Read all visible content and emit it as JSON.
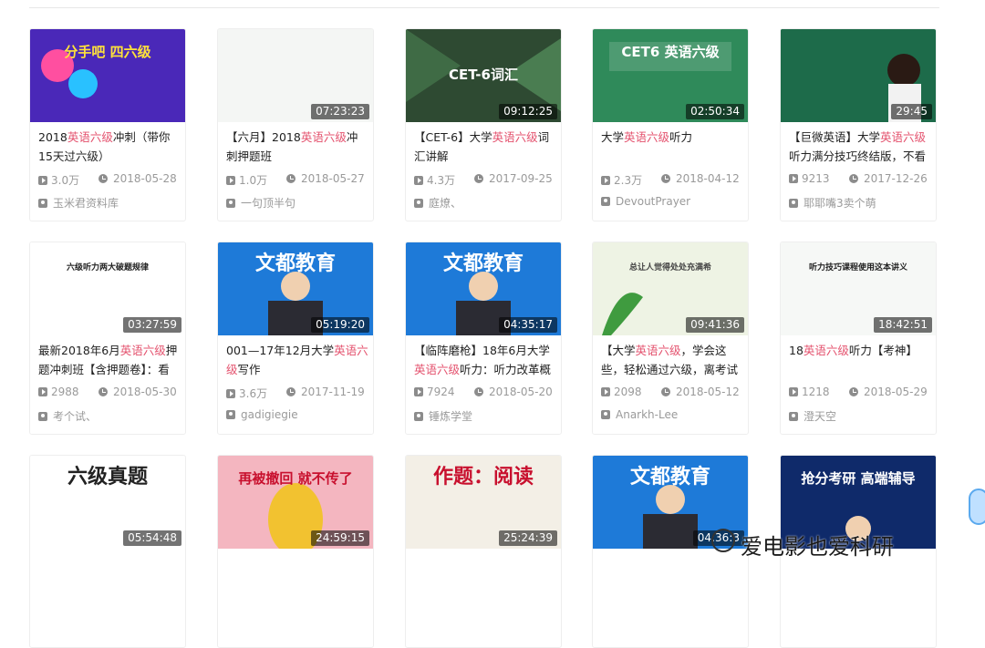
{
  "videos": [
    {
      "title_parts": [
        "2018",
        "英语六级",
        "冲刺（带你15天过六级）"
      ],
      "duration": "",
      "views": "3.0万",
      "date": "2018-05-28",
      "author": "玉米君资料库",
      "thumb": {
        "bg": "#4a28b8",
        "text": "分手吧 四六级",
        "fg": "#ffe23a"
      }
    },
    {
      "title_parts": [
        "【六月】2018",
        "英语六级",
        "冲刺押题班"
      ],
      "duration": "07:23:23",
      "views": "1.0万",
      "date": "2018-05-27",
      "author": "一句顶半句",
      "thumb": {
        "bg": "#f4f6f4",
        "text": "",
        "fg": "#333"
      }
    },
    {
      "title_parts": [
        "【CET-6】大学",
        "英语六级",
        "词汇讲解"
      ],
      "duration": "09:12:25",
      "views": "4.3万",
      "date": "2017-09-25",
      "author": "庭燎、",
      "thumb": {
        "bg": "#2e4a32",
        "text": "CET-6词汇",
        "fg": "#ffffff"
      }
    },
    {
      "title_parts": [
        "大学",
        "英语六级",
        "听力"
      ],
      "duration": "02:50:34",
      "views": "2.3万",
      "date": "2018-04-12",
      "author": "DevoutPrayer",
      "thumb": {
        "bg": "#2f8a5a",
        "text": "CET6 英语六级",
        "fg": "#ffffff"
      }
    },
    {
      "title_parts": [
        "【巨微英语】大学",
        "英语六级",
        "听力满分技巧终结版，不看"
      ],
      "duration": "29:45",
      "views": "9213",
      "date": "2017-12-26",
      "author": "耶耶嘴3卖个萌",
      "thumb": {
        "bg": "#1d6b4a",
        "text": "",
        "fg": "#fff"
      }
    },
    {
      "title_parts": [
        "最新2018年6月",
        "英语六级",
        "押题冲刺班【含押题卷】：看"
      ],
      "duration": "03:27:59",
      "views": "2988",
      "date": "2018-05-30",
      "author": "考个试、",
      "thumb": {
        "bg": "#ffffff",
        "text": "六级听力两大破题规律",
        "fg": "#222"
      }
    },
    {
      "title_parts": [
        "001—17年12月大学",
        "英语六级",
        "写作"
      ],
      "duration": "05:19:20",
      "views": "3.6万",
      "date": "2017-11-19",
      "author": "gadigiegie",
      "thumb": {
        "bg": "#1e7ad8",
        "text": "文都教育",
        "fg": "#fff"
      }
    },
    {
      "title_parts": [
        "【临阵磨枪】18年6月大学",
        "英语六级",
        "听力：听力改革概"
      ],
      "duration": "04:35:17",
      "views": "7924",
      "date": "2018-05-20",
      "author": "锤炼学堂",
      "thumb": {
        "bg": "#1e7ad8",
        "text": "文都教育",
        "fg": "#fff"
      }
    },
    {
      "title_parts": [
        "【大学",
        "英语六级",
        "，学会这些，轻松通过六级，离考试"
      ],
      "duration": "09:41:36",
      "views": "2098",
      "date": "2018-05-12",
      "author": "Anarkh-Lee",
      "thumb": {
        "bg": "#eef3e4",
        "text": "总让人觉得处处充满希",
        "fg": "#444"
      }
    },
    {
      "title_parts": [
        "18",
        "英语六级",
        "听力【考神】"
      ],
      "duration": "18:42:51",
      "views": "1218",
      "date": "2018-05-29",
      "author": "澄天空",
      "thumb": {
        "bg": "#f6f8f6",
        "text": "听力技巧课程使用这本讲义",
        "fg": "#222"
      }
    },
    {
      "title_parts": [
        "",
        "",
        ""
      ],
      "duration": "05:54:48",
      "views": "",
      "date": "",
      "author": "",
      "thumb": {
        "bg": "#ffffff",
        "text": "六级真题",
        "fg": "#222"
      }
    },
    {
      "title_parts": [
        "",
        "",
        ""
      ],
      "duration": "24:59:15",
      "views": "",
      "date": "",
      "author": "",
      "thumb": {
        "bg": "#f4b6c0",
        "text": "再被撤回 就不传了",
        "fg": "#c8102e"
      }
    },
    {
      "title_parts": [
        "",
        "",
        ""
      ],
      "duration": "25:24:39",
      "views": "",
      "date": "",
      "author": "",
      "thumb": {
        "bg": "#f3efe6",
        "text": "作题：阅读",
        "fg": "#c8102e"
      }
    },
    {
      "title_parts": [
        "",
        "",
        ""
      ],
      "duration": "04:36:3",
      "views": "",
      "date": "",
      "author": "",
      "thumb": {
        "bg": "#1e7ad8",
        "text": "文都教育",
        "fg": "#fff"
      }
    },
    {
      "title_parts": [
        "",
        "",
        ""
      ],
      "duration": "",
      "views": "",
      "date": "",
      "author": "",
      "thumb": {
        "bg": "#0f2a6a",
        "text": "抢分考研 高端辅导",
        "fg": "#fff"
      }
    }
  ],
  "watermark": "爱电影也爱科研",
  "colors": {
    "highlight": "#e4526e",
    "meta": "#9a9a9a"
  }
}
